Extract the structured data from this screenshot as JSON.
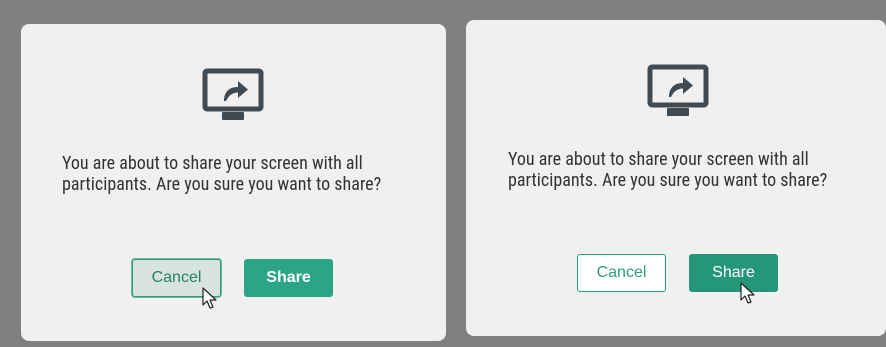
{
  "dialogs": [
    {
      "icon": "screen-share-icon",
      "message": "You are about to share your screen with all participants. Are you sure you want to share?",
      "cancel_label": "Cancel",
      "share_label": "Share",
      "hovered": "cancel"
    },
    {
      "icon": "screen-share-icon",
      "message": "You are about to share your screen with all participants. Are you sure you want to share?",
      "cancel_label": "Cancel",
      "share_label": "Share",
      "hovered": "share"
    }
  ],
  "colors": {
    "background": "#808080",
    "dialog": "#f0f0f0",
    "accent": "#2ba585",
    "icon": "#404a52"
  }
}
